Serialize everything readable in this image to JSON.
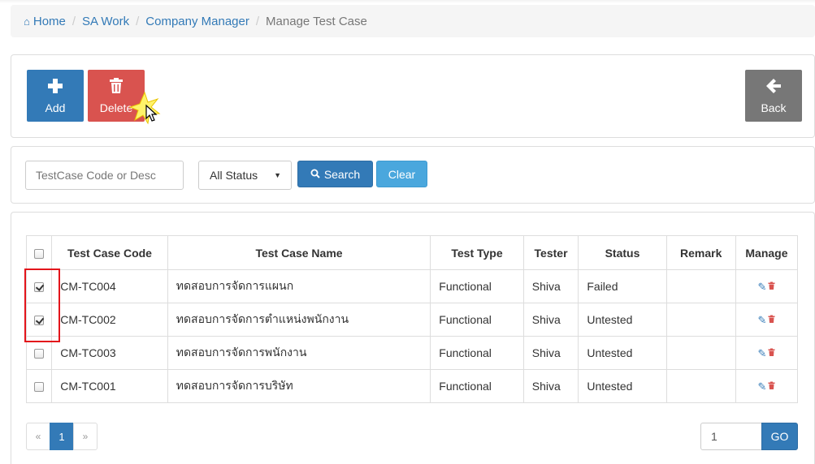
{
  "breadcrumb": {
    "home": "Home",
    "items": [
      "SA Work",
      "Company Manager"
    ],
    "current": "Manage Test Case"
  },
  "toolbar": {
    "add_label": "Add",
    "delete_label": "Delete",
    "back_label": "Back"
  },
  "filter": {
    "search_placeholder": "TestCase Code or Desc",
    "status_selected": "All Status",
    "search_label": "Search",
    "clear_label": "Clear"
  },
  "table": {
    "headers": [
      "Test Case Code",
      "Test Case Name",
      "Test Type",
      "Tester",
      "Status",
      "Remark",
      "Manage"
    ],
    "rows": [
      {
        "checked": true,
        "code": "CM-TC004",
        "name": "ทดสอบการจัดการแผนก",
        "type": "Functional",
        "tester": "Shiva",
        "status": "Failed",
        "remark": ""
      },
      {
        "checked": true,
        "code": "CM-TC002",
        "name": "ทดสอบการจัดการตำแหน่งพนักงาน",
        "type": "Functional",
        "tester": "Shiva",
        "status": "Untested",
        "remark": ""
      },
      {
        "checked": false,
        "code": "CM-TC003",
        "name": "ทดสอบการจัดการพนักงาน",
        "type": "Functional",
        "tester": "Shiva",
        "status": "Untested",
        "remark": ""
      },
      {
        "checked": false,
        "code": "CM-TC001",
        "name": "ทดสอบการจัดการบริษัท",
        "type": "Functional",
        "tester": "Shiva",
        "status": "Untested",
        "remark": ""
      }
    ]
  },
  "pagination": {
    "prev": "«",
    "current": "1",
    "next": "»",
    "goto_value": "1",
    "go_label": "GO"
  },
  "colors": {
    "primary": "#337ab7",
    "danger": "#d9534f",
    "default_dark": "#777777",
    "info": "#4aa7dd",
    "highlight": "#e3151b"
  }
}
